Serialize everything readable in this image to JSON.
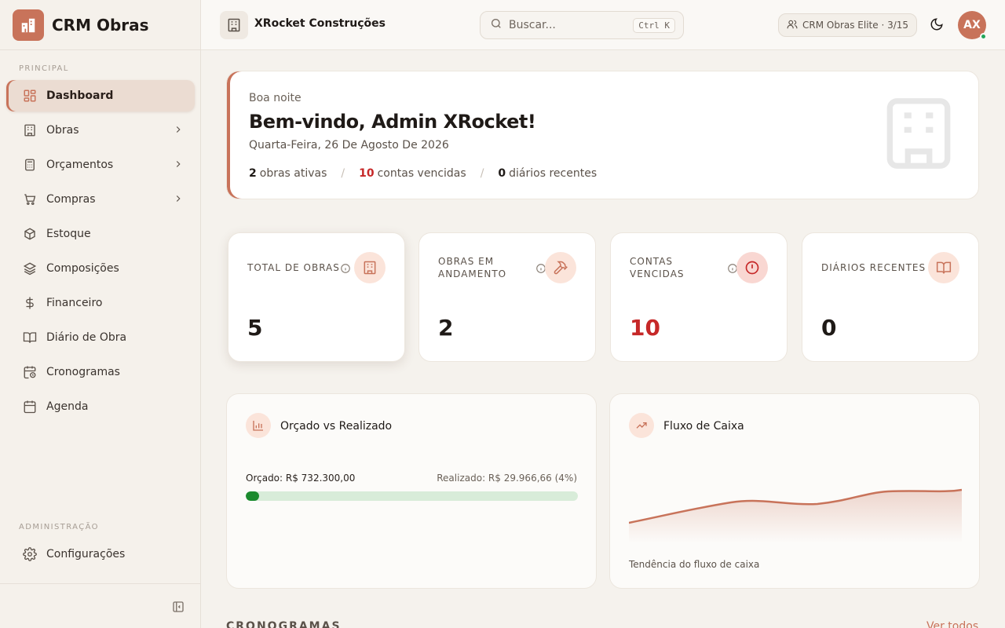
{
  "sidebar": {
    "brand": "CRM Obras",
    "section_principal": "PRINCIPAL",
    "section_admin": "ADMINISTRAÇÃO",
    "items": [
      {
        "label": "Dashboard",
        "icon": "grid-icon",
        "active": true
      },
      {
        "label": "Obras",
        "icon": "building-icon",
        "chevron": true
      },
      {
        "label": "Orçamentos",
        "icon": "calculator-icon",
        "chevron": true
      },
      {
        "label": "Compras",
        "icon": "cart-icon",
        "chevron": true
      },
      {
        "label": "Estoque",
        "icon": "box-icon"
      },
      {
        "label": "Composições",
        "icon": "layers-icon"
      },
      {
        "label": "Financeiro",
        "icon": "dollar-icon"
      },
      {
        "label": "Diário de Obra",
        "icon": "book-icon"
      },
      {
        "label": "Cronogramas",
        "icon": "calendar-clock-icon"
      },
      {
        "label": "Agenda",
        "icon": "calendar-icon"
      }
    ],
    "admin_items": [
      {
        "label": "Configurações",
        "icon": "gear-icon"
      }
    ]
  },
  "header": {
    "company": "XRocket Construções",
    "search_placeholder": "Buscar...",
    "shortcut": "Ctrl K",
    "plan": "CRM Obras Elite · 3/15",
    "avatar": "AX"
  },
  "welcome": {
    "greeting": "Boa noite",
    "title": "Bem-vindo, Admin XRocket!",
    "date": "Quarta-Feira, 26 De Agosto De 2026",
    "stats": [
      {
        "value": "2",
        "label": "obras ativas"
      },
      {
        "value": "10",
        "label": "contas vencidas"
      },
      {
        "value": "0",
        "label": "diários recentes"
      }
    ]
  },
  "kpis": [
    {
      "label": "TOTAL DE OBRAS",
      "value": "5"
    },
    {
      "label_l1": "OBRAS EM",
      "label_l2": "ANDAMENTO",
      "value": "2"
    },
    {
      "label_l1": "CONTAS",
      "label_l2": "VENCIDAS",
      "value": "10"
    },
    {
      "label": "DIÁRIOS RECENTES",
      "value": "0"
    }
  ],
  "budget_panel": {
    "title": "Orçado vs Realizado",
    "budgeted": "Orçado: R$ 732.300,00",
    "realized": "Realizado: R$ 29.966,66 (4%)",
    "percent": 4
  },
  "cash_panel": {
    "title": "Fluxo de Caixa",
    "caption": "Tendência do fluxo de caixa"
  },
  "next_section": {
    "heading": "CRONOGRAMAS",
    "link": "Ver todos"
  },
  "colors": {
    "accent": "#c8735a",
    "danger": "#c62828",
    "success": "#1b8a2e"
  }
}
